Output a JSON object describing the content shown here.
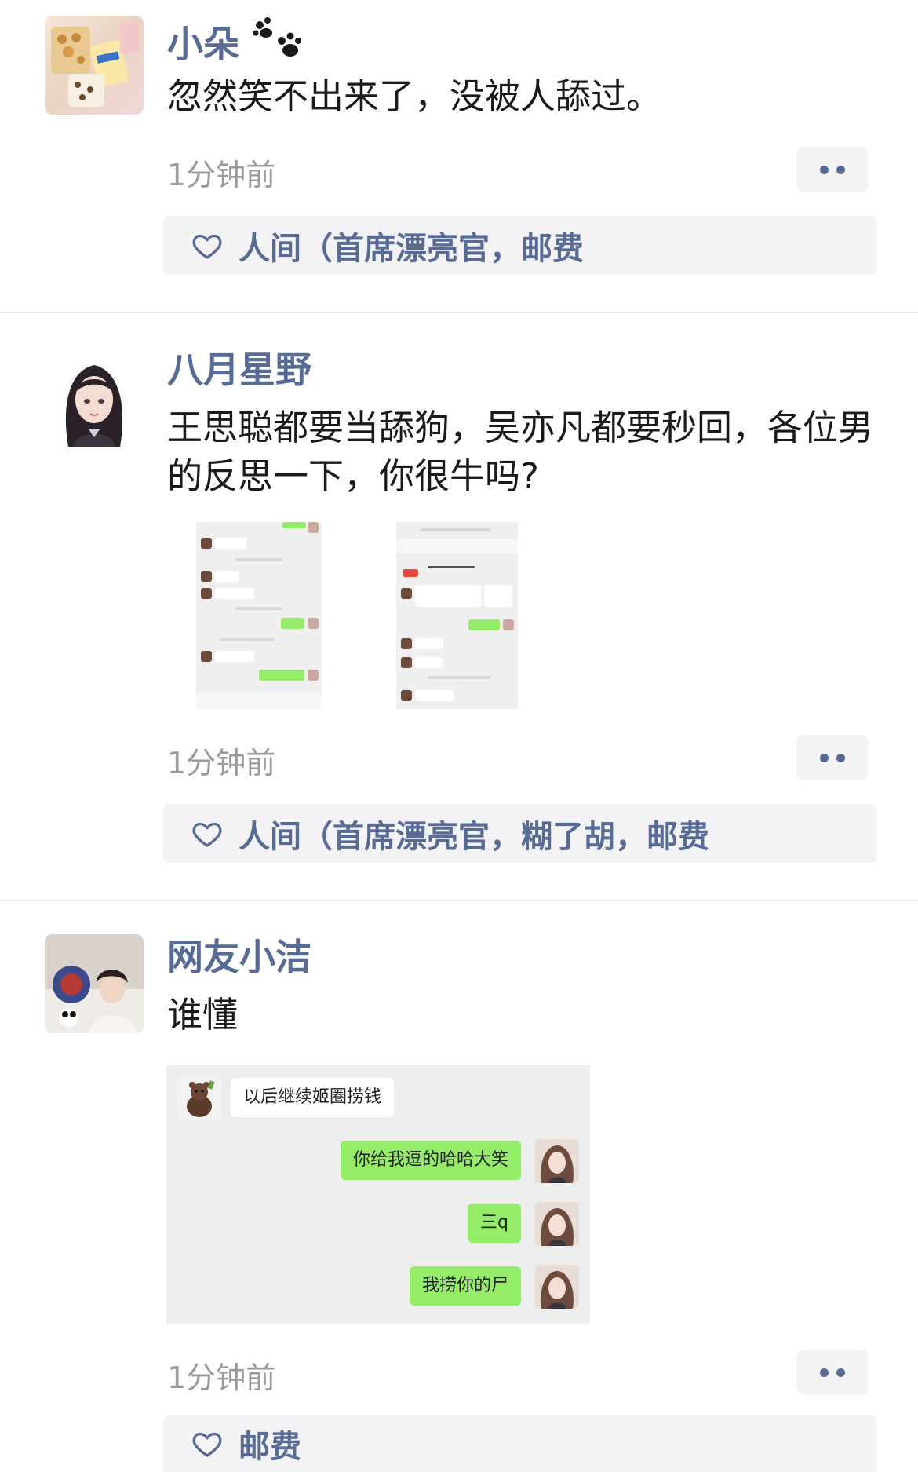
{
  "colors": {
    "nickname": "#576b95",
    "time": "#9a9a9a",
    "like_bg": "#f3f3f5",
    "chat_green": "#95ec69"
  },
  "posts": [
    {
      "nickname": "小朵",
      "nickname_icon": "paw-icon",
      "text": "忽然笑不出来了，没被人舔过。",
      "time": "1分钟前",
      "likes": "人间（首席漂亮官，邮费"
    },
    {
      "nickname": "八月星野",
      "text": "王思聪都要当舔狗，吴亦凡都要秒回，各位男的反思一下，你很牛吗?",
      "time": "1分钟前",
      "likes": "人间（首席漂亮官，糊了胡，邮费",
      "images": [
        "chat-screenshot-1",
        "chat-screenshot-2"
      ]
    },
    {
      "nickname": "网友小洁",
      "text": "谁懂",
      "time": "1分钟前",
      "likes": "邮费",
      "chat": {
        "incoming": "以后继续姬圈捞钱",
        "outgoing": [
          "你给我逗的哈哈大笑",
          "三q",
          "我捞你的尸"
        ]
      }
    }
  ]
}
